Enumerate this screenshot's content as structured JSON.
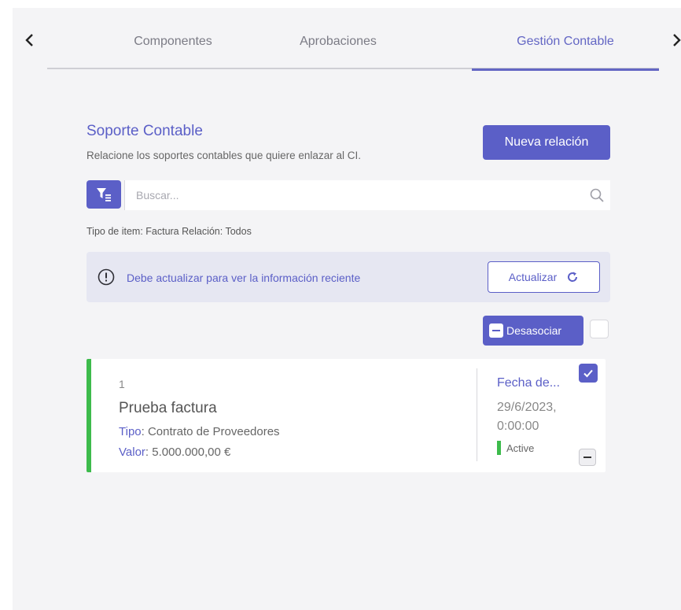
{
  "tabs": [
    {
      "label": "Componentes",
      "active": false
    },
    {
      "label": "Aprobaciones",
      "active": false
    },
    {
      "label": "Gestión Contable",
      "active": true
    }
  ],
  "section": {
    "title": "Soporte Contable",
    "subtitle": "Relacione los soportes contables que quiere enlazar al CI.",
    "new_button": "Nueva relación"
  },
  "search": {
    "placeholder": "Buscar...",
    "value": ""
  },
  "filter_summary": "Tipo de item: Factura Relación: Todos",
  "alert": {
    "message": "Debe actualizar para ver la información reciente",
    "button": "Actualizar"
  },
  "actions": {
    "desasociar": "Desasociar",
    "select_all_checked": false
  },
  "cards": [
    {
      "number": "1",
      "title": "Prueba factura",
      "tipo_label": "Tipo",
      "tipo_value": ": Contrato de Proveedores",
      "valor_label": "Valor",
      "valor_value": ": 5.000.000,00 €",
      "fecha_label": "Fecha de...",
      "fecha_value": "29/6/2023, 0:00:00",
      "status": "Active",
      "checked": true
    }
  ],
  "colors": {
    "accent": "#5b5fc7",
    "status_active": "#3dbb4c",
    "alert_bg": "#e6e7f2",
    "panel_bg": "#f4f4f6"
  }
}
